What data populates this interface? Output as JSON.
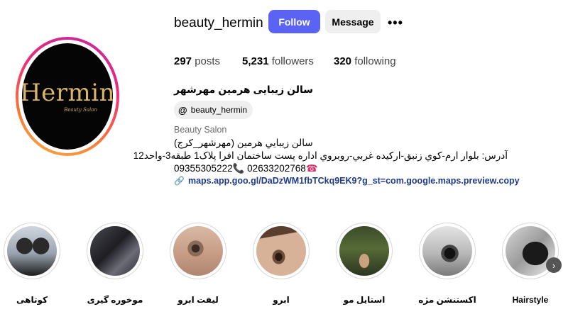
{
  "profile": {
    "username": "beauty_hermin",
    "follow_label": "Follow",
    "message_label": "Message",
    "more_icon": "more-horizontal-icon",
    "logo_text": "Hermin",
    "logo_subtitle": "Beauty Salon",
    "stats": {
      "posts_count": "297",
      "posts_label": "posts",
      "followers_count": "5,231",
      "followers_label": "followers",
      "following_count": "320",
      "following_label": "following"
    },
    "full_name": "سالن زیبایی هرمین مهرشهر",
    "threads_handle": "beauty_hermin",
    "category": "Beauty Salon",
    "bio_line1": "سالن زيبايي هرمين (مهرشهر_كرج)",
    "bio_line2": "آدرس: بلوار ارم-كوي زنبق-اركيده غربي-روبروي اداره پست ساختمان افرا پلاک1 طبقه3-واحد12",
    "bio_phone1": "02633202768",
    "bio_phone2": "09355305222",
    "link": "maps.app.goo.gl/DaDzWM1fbTCkq9EK9?g_st=com.google.maps.preview.copy"
  },
  "highlights": [
    {
      "label": "کوتاهی"
    },
    {
      "label": "موخوره گیری"
    },
    {
      "label": "لیفت ابرو"
    },
    {
      "label": "ابرو"
    },
    {
      "label": "استایل مو"
    },
    {
      "label": "اکستنشن مژه"
    },
    {
      "label": "Hairstyle"
    }
  ],
  "colors": {
    "follow_button": "#5b63f5",
    "message_button": "#efefef",
    "link": "#1e3a8a",
    "avatar_ring": [
      "#c026a3",
      "#ee2a7b",
      "#f77737",
      "#fcaf45"
    ],
    "logo_gold": "#d8b46a"
  }
}
